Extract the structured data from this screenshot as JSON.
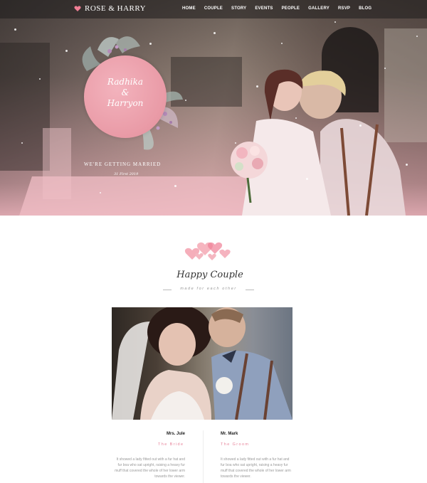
{
  "brand": {
    "name": "ROSE & HARRY",
    "heart_color": "#f07f95"
  },
  "nav": {
    "items": [
      "HOME",
      "COUPLE",
      "STORY",
      "EVENTS",
      "PEOPLE",
      "GALLERY",
      "RSVP",
      "BLOG"
    ]
  },
  "hero": {
    "names_line1": "Radhika",
    "names_amp": "&",
    "names_line2": "Harryon",
    "tagline": "WE'RE GETTING MARRIED",
    "date": "31 First 2019"
  },
  "couple_section": {
    "title": "Happy Couple",
    "subtitle": "made for each other",
    "accent_color": "#e7839a"
  },
  "bride": {
    "name": "Mrs. Jule",
    "role": "The Bride",
    "bio": "It showed a lady fitted out with a fur hat and fur boa who sat upright, raising a heavy fur muff that covered the whole of her lower arm towards the viewer."
  },
  "groom": {
    "name": "Mr. Mark",
    "role": "The Groom",
    "bio": "It showed a lady fitted out with a fur hat and fur boa who sat upright, raising a heavy fur muff that covered the whole of her lower arm towards the viewer."
  }
}
